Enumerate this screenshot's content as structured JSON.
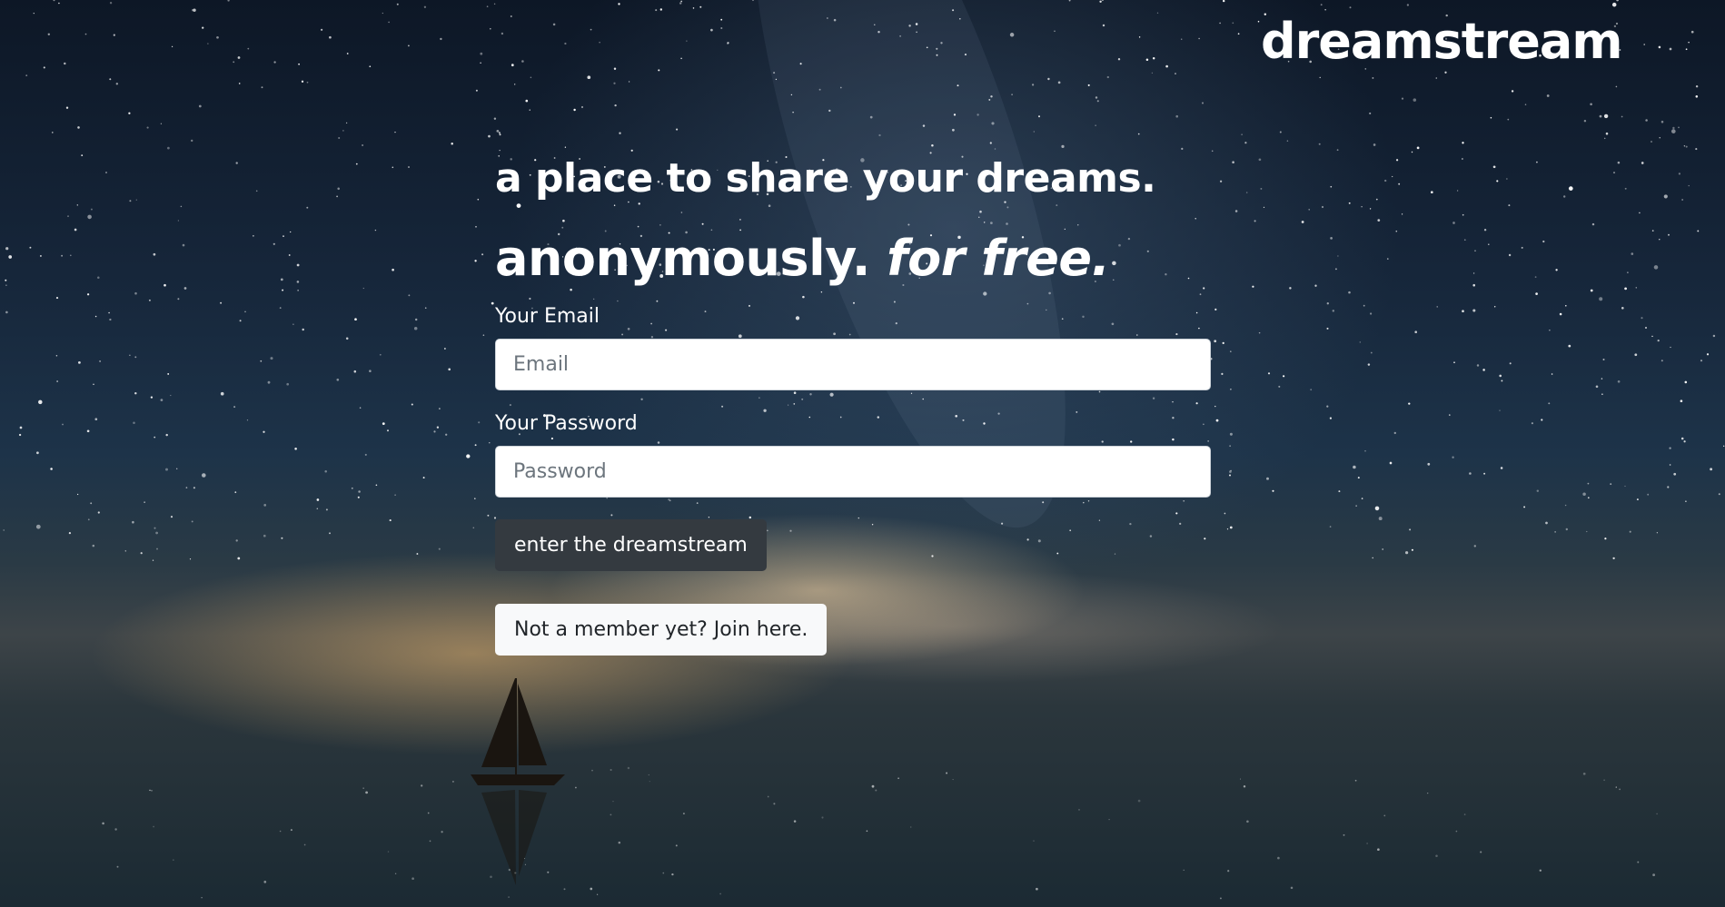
{
  "brand": {
    "name": "dreamstream"
  },
  "hero": {
    "line1": "a place to share your dreams.",
    "line2_plain": "anonymously.",
    "line2_emphasis": "for free."
  },
  "form": {
    "email_label": "Your Email",
    "email_placeholder": "Email",
    "email_value": "",
    "password_label": "Your Password",
    "password_placeholder": "Password",
    "password_value": "",
    "submit_label": "enter the dreamstream"
  },
  "signup": {
    "label": "Not a member yet? Join here."
  },
  "colors": {
    "primary_button": "#343a40",
    "secondary_button": "#f8f9fa",
    "text_light": "#ffffff"
  },
  "icons": [
    "boat-icon"
  ]
}
